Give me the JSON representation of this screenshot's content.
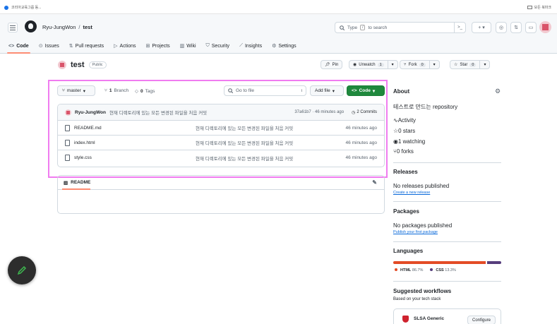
{
  "browser": {
    "bookmark_label": "코리아교육그룹 동...",
    "folder_label": "모든 북마크"
  },
  "header": {
    "owner": "Ryu-JungWon",
    "separator": "/",
    "repo": "test",
    "search_prefix": "Type",
    "search_key": "/",
    "search_suffix": "to search",
    "plus_label": "+"
  },
  "tabs": [
    {
      "label": "Code",
      "icon": "code-icon"
    },
    {
      "label": "Issues",
      "icon": "issue-icon"
    },
    {
      "label": "Pull requests",
      "icon": "pull-request-icon"
    },
    {
      "label": "Actions",
      "icon": "play-icon"
    },
    {
      "label": "Projects",
      "icon": "table-icon"
    },
    {
      "label": "Wiki",
      "icon": "book-icon"
    },
    {
      "label": "Security",
      "icon": "shield-icon"
    },
    {
      "label": "Insights",
      "icon": "graph-icon"
    },
    {
      "label": "Settings",
      "icon": "gear-icon"
    }
  ],
  "repo": {
    "name": "test",
    "visibility": "Public",
    "pin": "Pin",
    "unwatch": "Unwatch",
    "unwatch_count": "1",
    "fork": "Fork",
    "fork_count": "0",
    "star": "Star",
    "star_count": "0"
  },
  "toolbar": {
    "branch": "master",
    "branch_count": "1",
    "branch_label": "Branch",
    "tag_count": "0",
    "tag_label": "Tags",
    "gofile_placeholder": "Go to file",
    "gofile_key": "t",
    "add_file": "Add file",
    "code": "Code"
  },
  "commit": {
    "author": "Ryu-JungWon",
    "message": "현재 디렉토리에 있는 모든 변경된 파일을 처음 커밋",
    "hash": "37a61b7",
    "age": "46 minutes ago",
    "commits": "2 Commits"
  },
  "files": [
    {
      "name": "README.md",
      "message": "현재 디렉토리에 있는 모든 변경된 파일을 처음 커밋",
      "age": "46 minutes ago"
    },
    {
      "name": "index.html",
      "message": "현재 디렉토리에 있는 모든 변경된 파일을 처음 커밋",
      "age": "46 minutes ago"
    },
    {
      "name": "style.css",
      "message": "현재 디렉토리에 있는 모든 변경된 파일을 처음 커밋",
      "age": "46 minutes ago"
    }
  ],
  "readme": {
    "title": "README"
  },
  "about": {
    "title": "About",
    "description": "테스트로 만드는 repository",
    "activity": "Activity",
    "stars": "0 stars",
    "watching": "1 watching",
    "forks": "0 forks"
  },
  "releases": {
    "title": "Releases",
    "empty": "No releases published",
    "link": "Create a new release"
  },
  "packages": {
    "title": "Packages",
    "empty": "No packages published",
    "link": "Publish your first package"
  },
  "languages": {
    "title": "Languages",
    "items": [
      {
        "name": "HTML",
        "percent": "86.7%",
        "value": 86.7,
        "color": "#e34c26"
      },
      {
        "name": "CSS",
        "percent": "13.3%",
        "value": 13.3,
        "color": "#563d7c"
      }
    ]
  },
  "workflows": {
    "title": "Suggested workflows",
    "subtitle": "Based on your tech stack",
    "item": "SLSA Generic",
    "configure": "Configure"
  },
  "colors": {
    "accent": "#fd8c73",
    "primary_button": "#1f883d",
    "highlight_box": "#f07cf0"
  }
}
